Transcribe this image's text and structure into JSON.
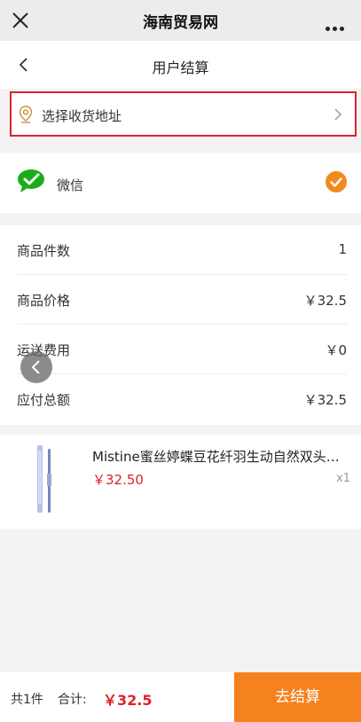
{
  "topbar": {
    "title": "海南贸易网",
    "close_icon": "close-icon",
    "more_icon": "more-dots-icon"
  },
  "navbar": {
    "title": "用户结算",
    "back_icon": "chevron-left-icon"
  },
  "address": {
    "label": "选择收货地址",
    "icon": "location-pin-icon",
    "chevron_icon": "chevron-right-icon",
    "highlight_color": "#e0202a"
  },
  "payment": {
    "label": "微信",
    "icon": "wechat-icon",
    "selected": true,
    "brand_color": "#1aad19",
    "check_color": "#f08a1c"
  },
  "summary": {
    "rows": [
      {
        "label": "商品件数",
        "value": "1"
      },
      {
        "label": "商品价格",
        "value": "￥32.5"
      },
      {
        "label": "运送费用",
        "value": "￥0"
      },
      {
        "label": "应付总额",
        "value": "￥32.5"
      }
    ]
  },
  "product": {
    "name": "Mistine蜜丝婷蝶豆花纤羽生动自然双头眉笔",
    "price": "￥32.50",
    "qty": "x1"
  },
  "footer": {
    "count": "共1件",
    "total_label": "合计:",
    "total": "￥32.5",
    "checkout_label": "去结算",
    "accent": "#f5821f"
  }
}
